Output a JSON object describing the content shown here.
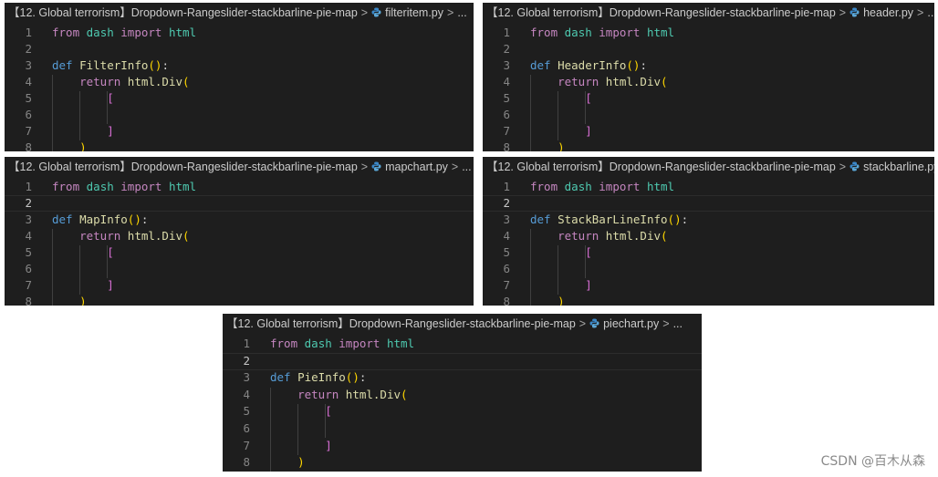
{
  "breadcrumb": {
    "folder": "【12. Global terrorism】",
    "project": "Dropdown-Rangeslider-stackbarline-pie-map",
    "separator": ">",
    "ellipsis": "...",
    "file_icon": "python-file-icon"
  },
  "panels": [
    {
      "file": "filteritem.py",
      "func": "FilterInfo",
      "active_line": null
    },
    {
      "file": "header.py",
      "func": "HeaderInfo",
      "active_line": null
    },
    {
      "file": "mapchart.py",
      "func": "MapInfo",
      "active_line": 2
    },
    {
      "file": "stackbarline.py",
      "func": "StackBarLineInfo",
      "active_line": 2
    },
    {
      "file": "piechart.py",
      "func": "PieInfo",
      "active_line": 2
    }
  ],
  "code": {
    "line_numbers": [
      "1",
      "2",
      "3",
      "4",
      "5",
      "6",
      "7",
      "8"
    ],
    "kw_from": "from",
    "mod_dash": "dash",
    "kw_import": "import",
    "mod_html": "html",
    "kw_def": "def",
    "paren_open": "(",
    "paren_close": ")",
    "colon": ":",
    "kw_return": "return",
    "html_div": "html.Div",
    "bracket_open": "[",
    "bracket_close": "]"
  },
  "watermark": "CSDN @百木从森",
  "colors": {
    "editor_bg": "#1e1e1e",
    "keyword": "#c586c0",
    "def": "#569cd6",
    "module": "#4ec9b0",
    "function": "#dcdcaa",
    "paren": "#ffd700",
    "bracket": "#da70d6"
  }
}
